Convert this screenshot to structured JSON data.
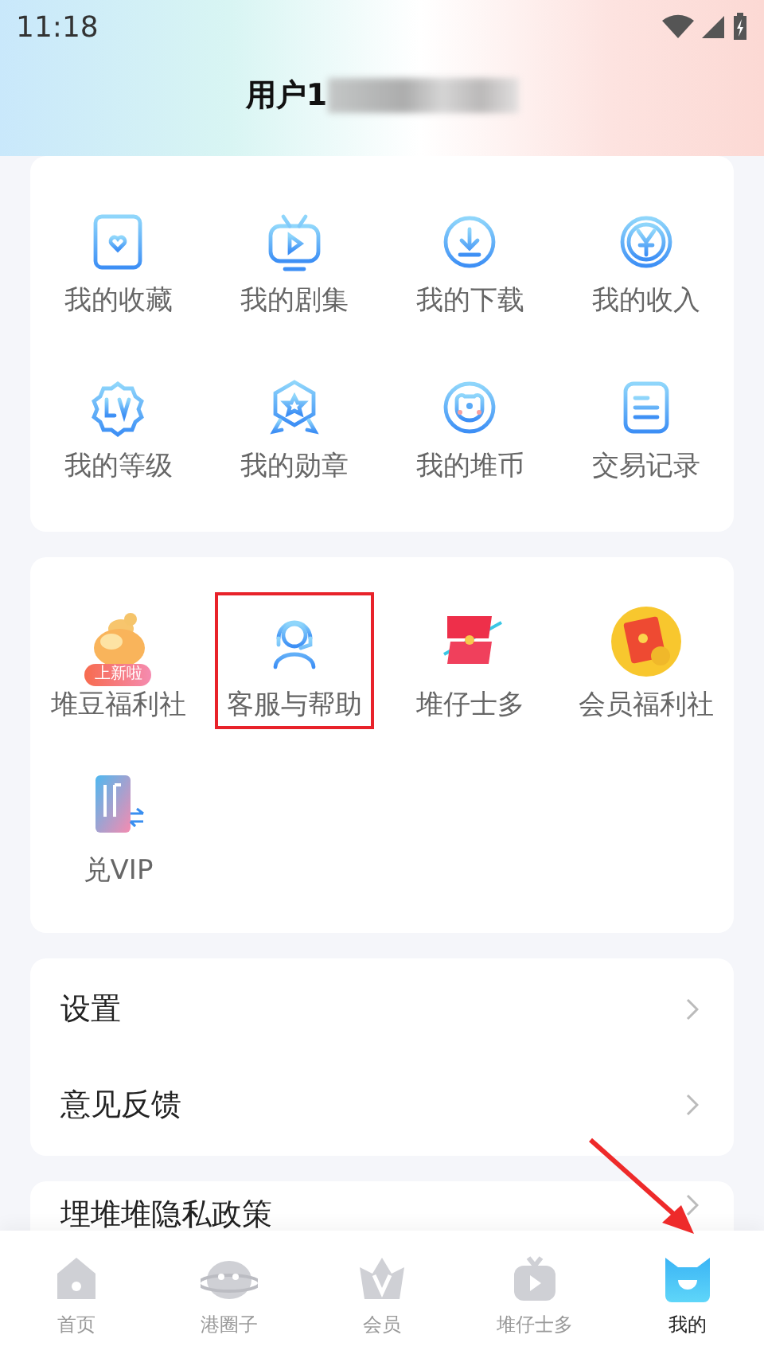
{
  "status_bar": {
    "time": "11:18"
  },
  "profile": {
    "username": "用户1",
    "redacted": true
  },
  "shortcuts": [
    {
      "label": "我的收藏"
    },
    {
      "label": "我的剧集"
    },
    {
      "label": "我的下载"
    },
    {
      "label": "我的收入"
    },
    {
      "label": "我的等级"
    },
    {
      "label": "我的勋章"
    },
    {
      "label": "我的堆币"
    },
    {
      "label": "交易记录"
    }
  ],
  "services": [
    {
      "label": "堆豆福利社",
      "highlighted": false,
      "badge": "上新啦"
    },
    {
      "label": "客服与帮助",
      "highlighted": true
    },
    {
      "label": "堆仔士多",
      "highlighted": false
    },
    {
      "label": "会员福利社",
      "highlighted": false
    },
    {
      "label": "兑VIP",
      "highlighted": false
    }
  ],
  "settings": [
    {
      "label": "设置"
    },
    {
      "label": "意见反馈"
    }
  ],
  "policy": {
    "label": "埋堆堆隐私政策"
  },
  "bottom_nav": [
    {
      "label": "首页",
      "selected": false,
      "arrow": false
    },
    {
      "label": "港圈子",
      "selected": false,
      "arrow": false
    },
    {
      "label": "会员",
      "selected": false,
      "arrow": false
    },
    {
      "label": "堆仔士多",
      "selected": false,
      "arrow": false
    },
    {
      "label": "我的",
      "selected": true,
      "arrow": true
    }
  ]
}
